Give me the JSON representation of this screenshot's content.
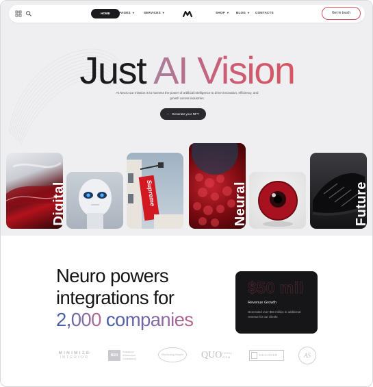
{
  "nav": {
    "items": [
      {
        "label": "HOME",
        "active": true
      },
      {
        "label": "PAGES",
        "caret": "▾"
      },
      {
        "label": "SERVICES",
        "caret": "▾"
      },
      {
        "label": "SHOP",
        "caret": "▾"
      },
      {
        "label": "BLOG",
        "caret": "▾"
      },
      {
        "label": "CONTACTS"
      }
    ],
    "cta_label": "Get in touch"
  },
  "hero": {
    "title_part1": "Just ",
    "title_part2": "AI Vision",
    "subtitle": "At Neuro our mission is to harness the power of artificial intelligence to drive innovation, efficiency, and growth across industries.",
    "button_label": "Generate your NFT",
    "button_icon": "chevron-right-icon"
  },
  "gallery": {
    "labels": [
      "Digital",
      "Neural",
      "Future"
    ],
    "sign_text": "Supreme"
  },
  "section2": {
    "heading_line1": "Neuro powers",
    "heading_line2": "integrations for",
    "heading_line3_number": "2,000",
    "heading_line3_rest": " companies"
  },
  "stat_card": {
    "value": "$50 mil",
    "label": "Revenue Growth",
    "description": "Generated over $50 million in additional revenue for our clients"
  },
  "brands": {
    "minimize_line1": "M I N I M I Z E",
    "minimize_line2": "I N T E R I O R",
    "box_text": "BRD",
    "box_caption_1": "Residence",
    "box_caption_2": "Architecture",
    "box_caption_3": "Consultancy",
    "script_logo": "Marketing Studio",
    "quo_main": "QUO",
    "quo_sub1": "LEGAL",
    "quo_sub2": "FIRM",
    "framed": "DESIGNER",
    "monogram": "AS"
  },
  "colors": {
    "accent_red": "#d65560",
    "dark": "#1b1b1f",
    "blue_gradient_start": "#3e5ba8"
  }
}
